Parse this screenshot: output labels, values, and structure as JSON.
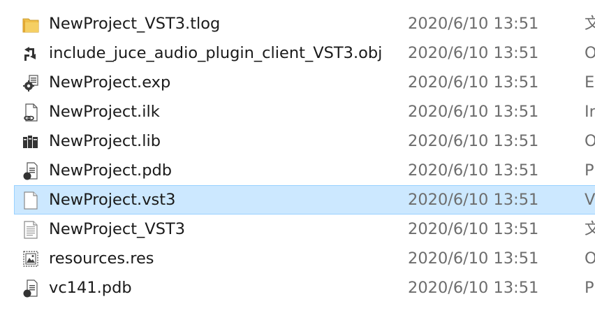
{
  "files": [
    {
      "name": "NewProject_VST3.tlog",
      "date": "2020/6/10 13:51",
      "type": "文",
      "icon": "folder-icon",
      "selected": false
    },
    {
      "name": "include_juce_audio_plugin_client_VST3.obj",
      "date": "2020/6/10 13:51",
      "type": "O",
      "icon": "object-file-icon",
      "selected": false
    },
    {
      "name": "NewProject.exp",
      "date": "2020/6/10 13:51",
      "type": "E",
      "icon": "exp-file-icon",
      "selected": false
    },
    {
      "name": "NewProject.ilk",
      "date": "2020/6/10 13:51",
      "type": "In",
      "icon": "ilk-file-icon",
      "selected": false
    },
    {
      "name": "NewProject.lib",
      "date": "2020/6/10 13:51",
      "type": "O",
      "icon": "library-file-icon",
      "selected": false
    },
    {
      "name": "NewProject.pdb",
      "date": "2020/6/10 13:51",
      "type": "P",
      "icon": "pdb-file-icon",
      "selected": false
    },
    {
      "name": "NewProject.vst3",
      "date": "2020/6/10 13:51",
      "type": "V",
      "icon": "blank-file-icon",
      "selected": true
    },
    {
      "name": "NewProject_VST3",
      "date": "2020/6/10 13:51",
      "type": "文",
      "icon": "text-file-icon",
      "selected": false
    },
    {
      "name": "resources.res",
      "date": "2020/6/10 13:51",
      "type": "O",
      "icon": "resource-file-icon",
      "selected": false
    },
    {
      "name": "vc141.pdb",
      "date": "2020/6/10 13:51",
      "type": "P",
      "icon": "pdb-file-icon",
      "selected": false
    }
  ],
  "colors": {
    "selection_bg": "#cce8ff",
    "selection_border": "#99d1ff",
    "folder": "#e8b94a"
  }
}
